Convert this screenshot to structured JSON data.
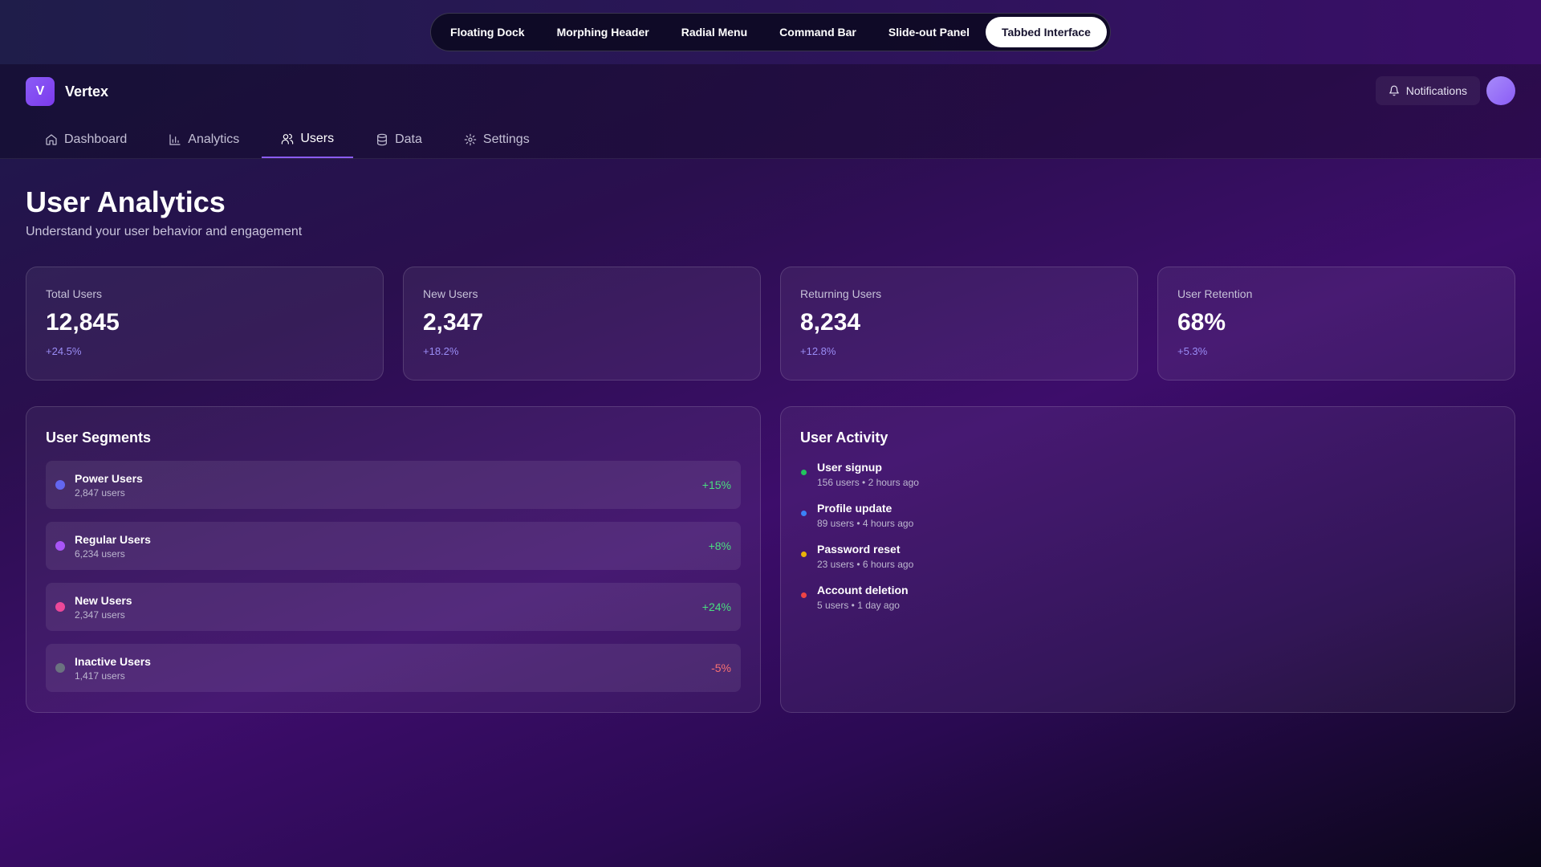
{
  "switcher": {
    "items": [
      "Floating Dock",
      "Morphing Header",
      "Radial Menu",
      "Command Bar",
      "Slide-out Panel",
      "Tabbed Interface"
    ],
    "active": "Tabbed Interface"
  },
  "brand": {
    "logo_letter": "V",
    "name": "Vertex"
  },
  "header": {
    "notifications_label": "Notifications"
  },
  "nav": {
    "tabs": [
      {
        "label": "Dashboard",
        "icon": "home-icon"
      },
      {
        "label": "Analytics",
        "icon": "bar-chart-icon"
      },
      {
        "label": "Users",
        "icon": "users-icon"
      },
      {
        "label": "Data",
        "icon": "database-icon"
      },
      {
        "label": "Settings",
        "icon": "gear-icon"
      }
    ],
    "active": "Users"
  },
  "page": {
    "title": "User Analytics",
    "subtitle": "Understand your user behavior and engagement"
  },
  "stats": [
    {
      "label": "Total Users",
      "value": "12,845",
      "change": "+24.5%"
    },
    {
      "label": "New Users",
      "value": "2,347",
      "change": "+18.2%"
    },
    {
      "label": "Returning Users",
      "value": "8,234",
      "change": "+12.8%"
    },
    {
      "label": "User Retention",
      "value": "68%",
      "change": "+5.3%"
    }
  ],
  "segments": {
    "title": "User Segments",
    "items": [
      {
        "name": "Power Users",
        "count": "2,847 users",
        "change": "+15%",
        "dot_color": "#6366f1",
        "change_color": "#4ade80"
      },
      {
        "name": "Regular Users",
        "count": "6,234 users",
        "change": "+8%",
        "dot_color": "#a855f7",
        "change_color": "#4ade80"
      },
      {
        "name": "New Users",
        "count": "2,347 users",
        "change": "+24%",
        "dot_color": "#ec4899",
        "change_color": "#4ade80"
      },
      {
        "name": "Inactive Users",
        "count": "1,417 users",
        "change": "-5%",
        "dot_color": "#6b7280",
        "change_color": "#f87171"
      }
    ]
  },
  "activity": {
    "title": "User Activity",
    "items": [
      {
        "title": "User signup",
        "meta": "156 users • 2 hours ago",
        "dot_color": "#22c55e"
      },
      {
        "title": "Profile update",
        "meta": "89 users • 4 hours ago",
        "dot_color": "#3b82f6"
      },
      {
        "title": "Password reset",
        "meta": "23 users • 6 hours ago",
        "dot_color": "#eab308"
      },
      {
        "title": "Account deletion",
        "meta": "5 users • 1 day ago",
        "dot_color": "#ef4444"
      }
    ]
  }
}
